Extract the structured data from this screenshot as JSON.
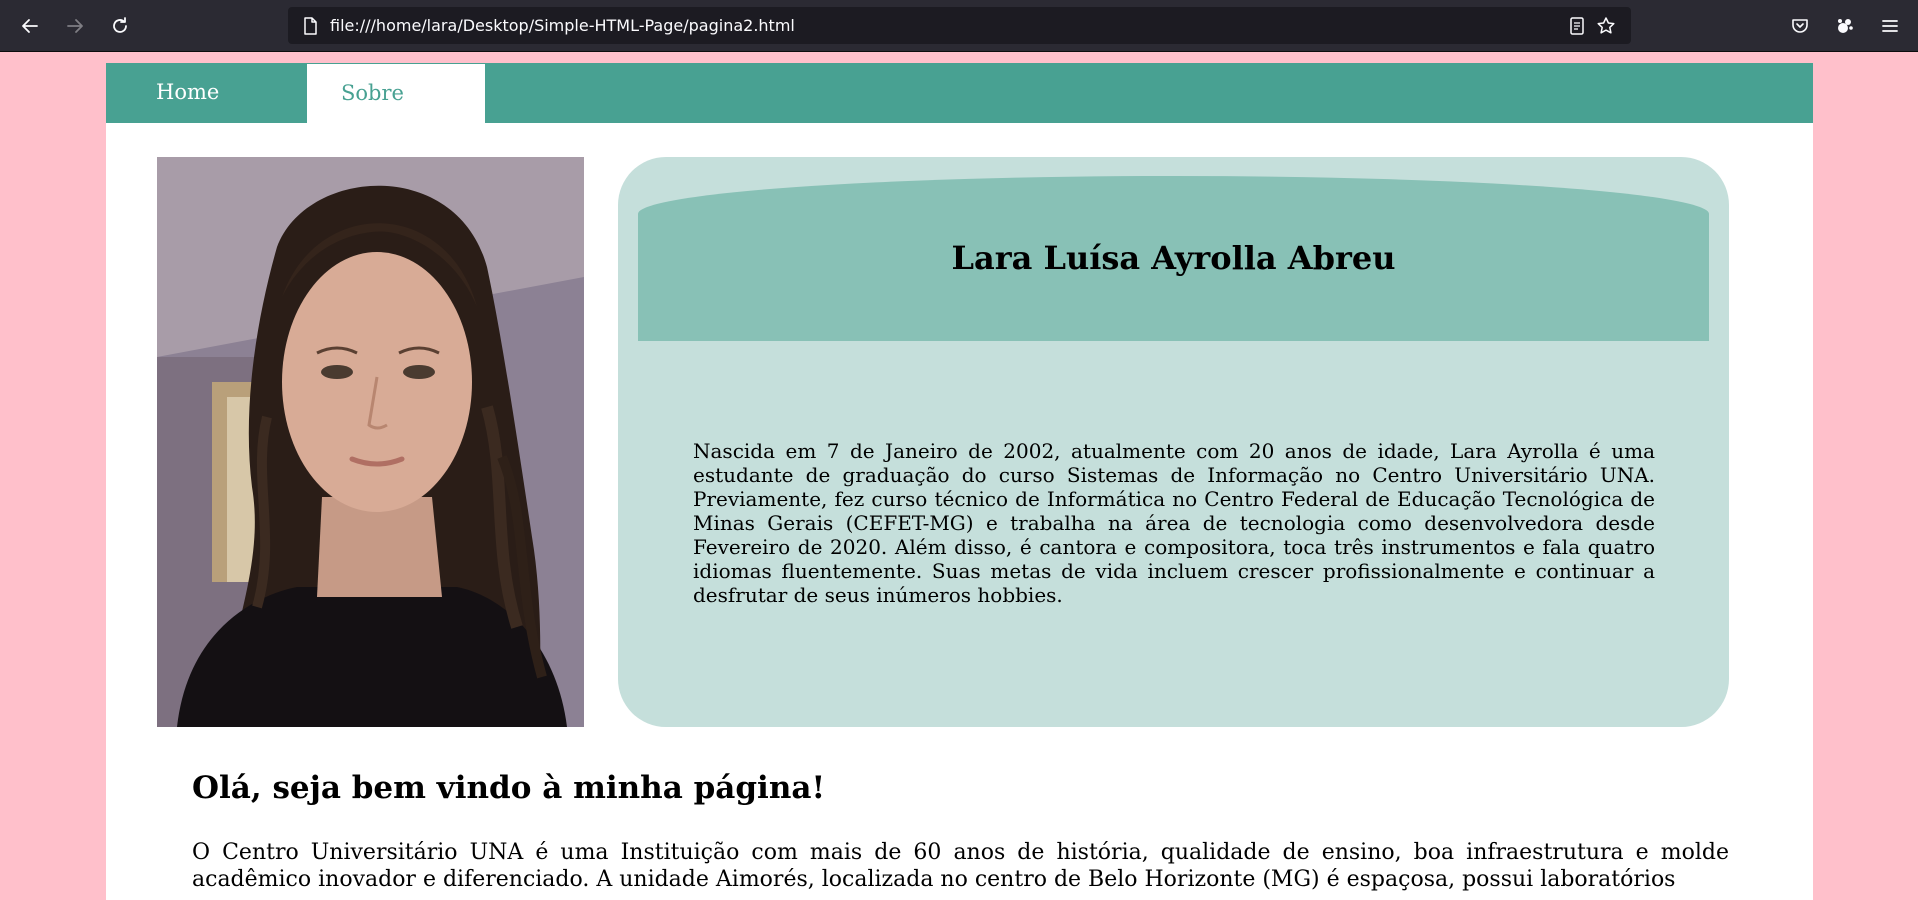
{
  "browser": {
    "url": "file:///home/lara/Desktop/Simple-HTML-Page/pagina2.html",
    "icons": {
      "back": "back-arrow-icon",
      "forward": "forward-arrow-icon",
      "reload": "reload-icon",
      "page": "page-icon",
      "reader": "reader-view-icon",
      "bookmark": "bookmark-star-icon",
      "pocket": "pocket-icon",
      "extension": "extension-icon",
      "menu": "hamburger-menu-icon"
    }
  },
  "nav": {
    "items": [
      {
        "label": "Home",
        "active": false
      },
      {
        "label": "Sobre",
        "active": true
      }
    ]
  },
  "profile": {
    "name": "Lara Luísa Ayrolla Abreu",
    "bio": "Nascida em 7 de Janeiro de 2002, atualmente com 20 anos de idade, Lara Ayrolla é uma estudante de graduação do curso Sistemas de Informação no Centro Universitário UNA. Previamente, fez curso técnico de Informática no Centro Federal de Educação Tecnológica de Minas Gerais (CEFET-MG) e trabalha na área de tecnologia como desenvolvedora desde Fevereiro de 2020. Além disso, é cantora e compositora, toca três instrumentos e fala quatro idiomas fluentemente. Suas metas de vida incluem crescer profissionalmente e continuar a desfrutar de seus inúmeros hobbies."
  },
  "main": {
    "heading": "Olá, seja bem vindo à minha página!",
    "paragraph": "O Centro Universitário UNA é uma Instituição com mais de 60 anos de história, qualidade de ensino, boa infraestrutura e molde acadêmico inovador e diferenciado. A unidade Aimorés, localizada no centro de Belo Horizonte (MG) é espaçosa, possui laboratórios"
  },
  "colors": {
    "page_background": "#ffc0cb",
    "nav_background": "#48a192",
    "card_background": "#c5dfdb",
    "card_header": "#88c1b6",
    "browser_toolbar": "#2b2a33"
  }
}
